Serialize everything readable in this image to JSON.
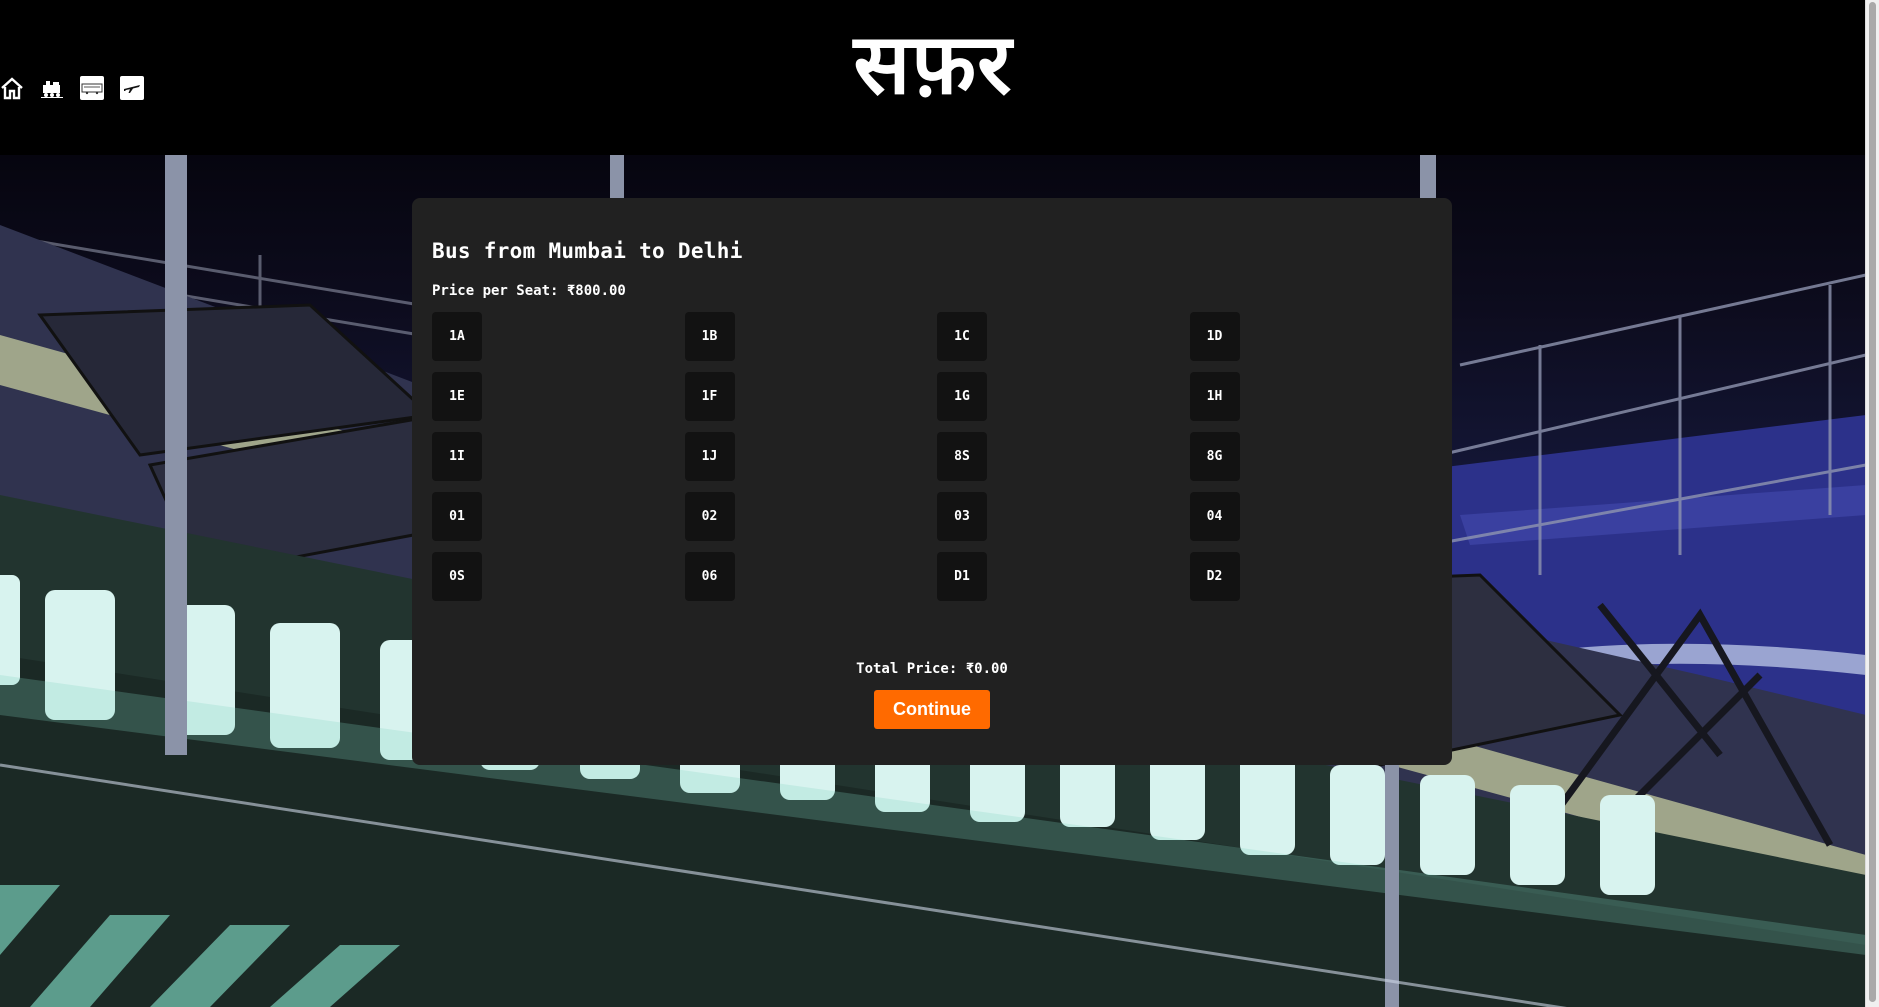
{
  "header": {
    "logo_text": "सफ़र",
    "nav": [
      {
        "icon": "home-icon"
      },
      {
        "icon": "train-icon"
      },
      {
        "icon": "bus-icon"
      },
      {
        "icon": "plane-icon"
      }
    ]
  },
  "booking": {
    "title": "Bus from Mumbai to Delhi",
    "price_per_seat": "Price per Seat: ₹800.00",
    "seats": [
      "1A",
      "1B",
      "1C",
      "1D",
      "1E",
      "1F",
      "1G",
      "1H",
      "1I",
      "1J",
      "8S",
      "8G",
      "01",
      "02",
      "03",
      "04",
      "0S",
      "06",
      "D1",
      "D2"
    ],
    "total_price": "Total Price: ₹0.00",
    "continue_label": "Continue"
  },
  "colors": {
    "panel_bg": "#212121",
    "seat_bg": "#121212",
    "accent": "#ff6a00",
    "header_bg": "#000000"
  }
}
